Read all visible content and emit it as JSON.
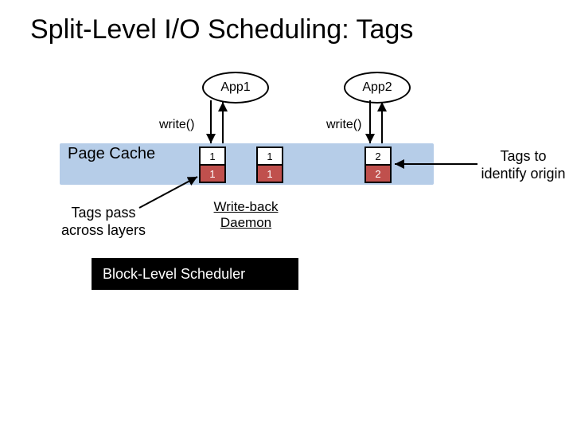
{
  "title": "Split-Level I/O Scheduling: Tags",
  "apps": {
    "a1": "App1",
    "a2": "App2"
  },
  "write": {
    "w1": "write()",
    "w2": "write()"
  },
  "pagecache": "Page Cache",
  "tags": {
    "c1t": "1",
    "c1b": "1",
    "c2t": "1",
    "c2b": "1",
    "c3t": "2",
    "c3b": "2"
  },
  "wbd_l1": "Write-back",
  "wbd_l2": "Daemon",
  "block": "Block-Level Scheduler",
  "note_left_l1": "Tags pass",
  "note_left_l2": "across layers",
  "note_right_l1": "Tags to",
  "note_right_l2": "identify origin"
}
